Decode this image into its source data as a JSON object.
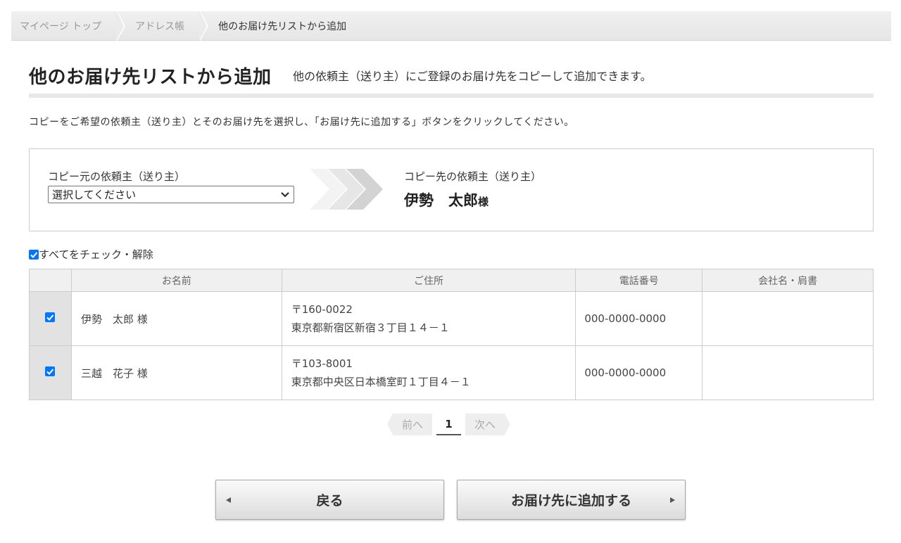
{
  "breadcrumb": {
    "items": [
      "マイページ トップ",
      "アドレス帳",
      "他のお届け先リストから追加"
    ]
  },
  "header": {
    "title": "他のお届け先リストから追加",
    "subtitle": "他の依頼主（送り主）にご登録のお届け先をコピーして追加できます。"
  },
  "instruction": "コピーをご希望の依頼主（送り主）とそのお届け先を選択し、「お届け先に追加する」ボタンをクリックしてください。",
  "copy_box": {
    "source_label": "コピー元の依頼主（送り主）",
    "source_select_value": "選択してください",
    "dest_label": "コピー先の依頼主（送り主）",
    "dest_name": "伊勢　太郎",
    "dest_suffix": "様"
  },
  "check_all": {
    "label": "すべてをチェック・解除",
    "checked": true
  },
  "table": {
    "columns": [
      "",
      "お名前",
      "ご住所",
      "電話番号",
      "会社名・肩書"
    ],
    "rows": [
      {
        "checked": true,
        "name": "伊勢　太郎 様",
        "postal": "〒160-0022",
        "address": "東京都新宿区新宿３丁目１４－１",
        "tel": "000-0000-0000",
        "company": ""
      },
      {
        "checked": true,
        "name": "三越　花子 様",
        "postal": "〒103-8001",
        "address": "東京都中央区日本橋室町１丁目４－１",
        "tel": "000-0000-0000",
        "company": ""
      }
    ]
  },
  "pager": {
    "prev": "前へ",
    "current": "1",
    "next": "次へ"
  },
  "buttons": {
    "back": "戻る",
    "add": "お届け先に追加する"
  },
  "colors": {
    "checkbox": "#0075ff",
    "header_bg": "#f0f0f0",
    "checkbox_cell_bg": "#e2e2e2"
  }
}
